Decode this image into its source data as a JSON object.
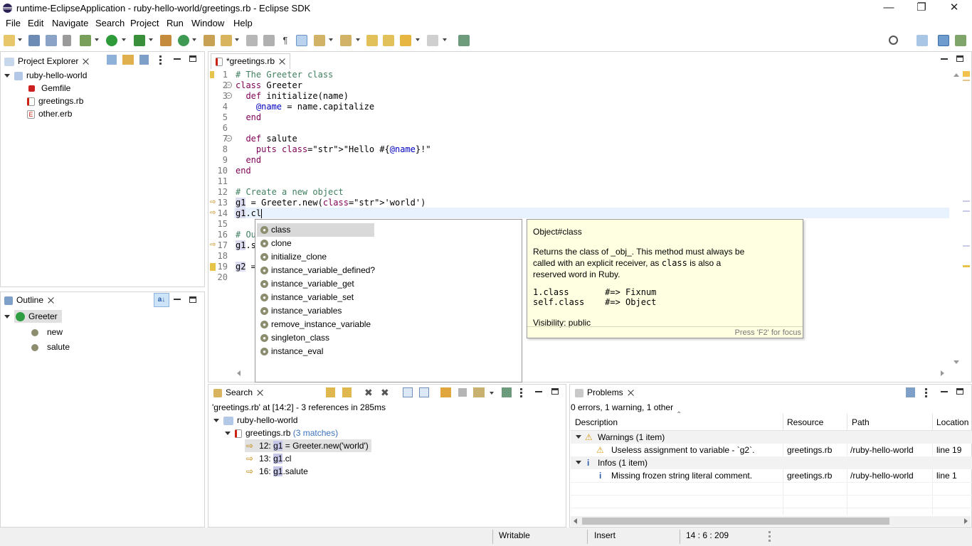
{
  "window": {
    "title": "runtime-EclipseApplication - ruby-hello-world/greetings.rb - Eclipse SDK",
    "minimize": "—",
    "restore": "❐",
    "close": "✕"
  },
  "menu": [
    "File",
    "Edit",
    "Navigate",
    "Search",
    "Project",
    "Run",
    "Window",
    "Help"
  ],
  "project_explorer": {
    "title": "Project Explorer",
    "tree": {
      "project": "ruby-hello-world",
      "files": [
        "Gemfile",
        "greetings.rb",
        "other.erb"
      ]
    }
  },
  "outline": {
    "title": "Outline",
    "class_name": "Greeter",
    "methods": [
      "new",
      "salute"
    ]
  },
  "editor": {
    "tab_label": "*greetings.rb",
    "lines": [
      {
        "n": "1",
        "code": "# The Greeter class"
      },
      {
        "n": "2",
        "code": "class Greeter"
      },
      {
        "n": "3",
        "code": "  def initialize(name)"
      },
      {
        "n": "4",
        "code": "    @name = name.capitalize"
      },
      {
        "n": "5",
        "code": "  end"
      },
      {
        "n": "6",
        "code": ""
      },
      {
        "n": "7",
        "code": "  def salute"
      },
      {
        "n": "8",
        "code": "    puts \"Hello #{@name}!\""
      },
      {
        "n": "9",
        "code": "  end"
      },
      {
        "n": "10",
        "code": "end"
      },
      {
        "n": "11",
        "code": ""
      },
      {
        "n": "12",
        "code": "# Create a new object"
      },
      {
        "n": "13",
        "code": "g1 = Greeter.new('world')"
      },
      {
        "n": "14",
        "code": "g1.cl"
      },
      {
        "n": "15",
        "code": ""
      },
      {
        "n": "16",
        "code": "# Ou"
      },
      {
        "n": "17",
        "code": "g1.s"
      },
      {
        "n": "18",
        "code": ""
      },
      {
        "n": "19",
        "code": "g2 ="
      },
      {
        "n": "20",
        "code": ""
      }
    ]
  },
  "completion": {
    "items": [
      "class",
      "clone",
      "initialize_clone",
      "instance_variable_defined?",
      "instance_variable_get",
      "instance_variable_set",
      "instance_variables",
      "remove_instance_variable",
      "singleton_class",
      "instance_eval"
    ],
    "selected": "class"
  },
  "doc": {
    "title": "Object#class",
    "body1": "Returns the class of _obj_. This method must always be",
    "body2_pre": "called with an explicit receiver, as ",
    "body2_code": "class",
    "body2_post": " is also a",
    "body3": "reserved word in Ruby.",
    "example1": "1.class       #=> Fixnum",
    "example2": "self.class    #=> Object",
    "visibility": "Visibility: public",
    "hint": "Press 'F2' for focus"
  },
  "search": {
    "title": "Search",
    "summary": "'greetings.rb' at [14:2] - 3 references in 285ms",
    "project": "ruby-hello-world",
    "file": "greetings.rb",
    "matches_label": "(3 matches)",
    "results": [
      {
        "prefix": "12: ",
        "match": "g1",
        "rest": " = Greeter.new('world')"
      },
      {
        "prefix": "13: ",
        "match": "g1",
        "rest": ".cl"
      },
      {
        "prefix": "16: ",
        "match": "g1",
        "rest": ".salute"
      }
    ]
  },
  "problems": {
    "title": "Problems",
    "summary": "0 errors, 1 warning, 1 other",
    "columns": [
      "Description",
      "Resource",
      "Path",
      "Location"
    ],
    "warnings_group": "Warnings (1 item)",
    "warning": {
      "desc": "Useless assignment to variable - `g2`.",
      "resource": "greetings.rb",
      "path": "/ruby-hello-world",
      "location": "line 19"
    },
    "infos_group": "Infos (1 item)",
    "info": {
      "desc": "Missing frozen string literal comment.",
      "resource": "greetings.rb",
      "path": "/ruby-hello-world",
      "location": "line 1"
    }
  },
  "status": {
    "writable": "Writable",
    "insert": "Insert",
    "position": "14 : 6 : 209"
  }
}
